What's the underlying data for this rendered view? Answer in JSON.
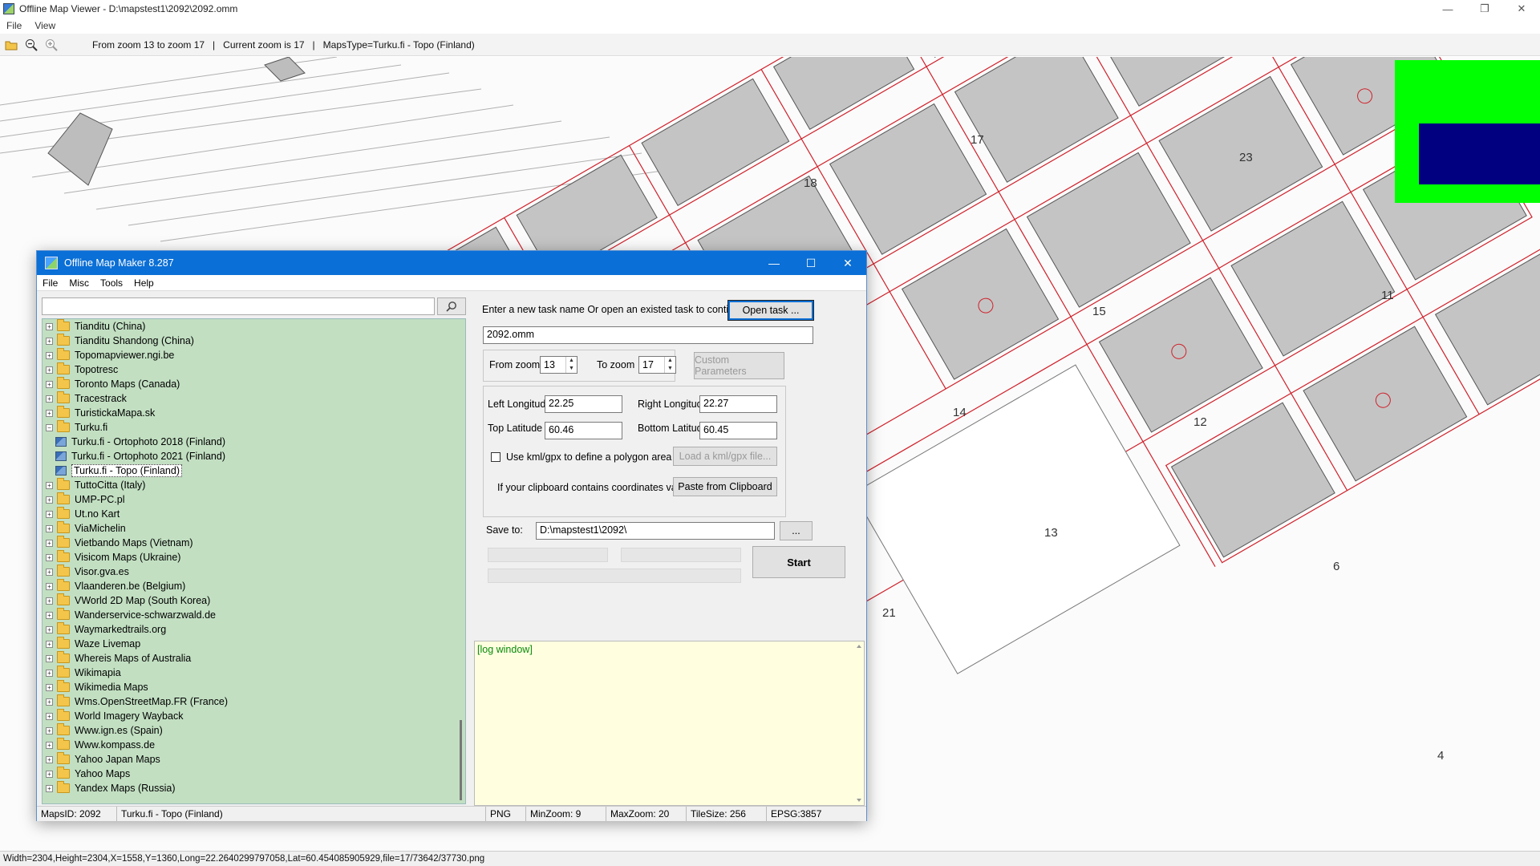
{
  "window": {
    "title": "Offline Map Viewer - D:\\mapstest1\\2092\\2092.omm",
    "menu": [
      "File",
      "View"
    ],
    "controls": [
      "—",
      "❐",
      "✕"
    ]
  },
  "toolbar": {
    "info": "From zoom 13 to zoom 17   |   Current zoom is 17   |   MapsType=Turku.fi - Topo (Finland)"
  },
  "map": {
    "labels": [
      "17",
      "23",
      "18",
      "15",
      "11",
      "14",
      "12",
      "13",
      "6",
      "4",
      "21"
    ],
    "overview_colors": {
      "outer": "#00ff00",
      "inner": "#000080"
    }
  },
  "status": {
    "text": "Width=2304,Height=2304,X=1558,Y=1360,Long=22.2640299797058,Lat=60.454085905929,file=17/73642/37730.png"
  },
  "dialog": {
    "title": "Offline Map Maker 8.287",
    "menu": [
      "File",
      "Misc",
      "Tools",
      "Help"
    ],
    "search": {
      "value": "",
      "placeholder": ""
    },
    "tree": [
      {
        "label": "Tianditu (China)",
        "type": "folder",
        "exp": "+"
      },
      {
        "label": "Tianditu Shandong (China)",
        "type": "folder",
        "exp": "+"
      },
      {
        "label": "Topomapviewer.ngi.be",
        "type": "folder",
        "exp": "+"
      },
      {
        "label": "Topotresc",
        "type": "folder",
        "exp": "+"
      },
      {
        "label": "Toronto Maps (Canada)",
        "type": "folder",
        "exp": "+"
      },
      {
        "label": "Tracestrack",
        "type": "folder",
        "exp": "+"
      },
      {
        "label": "TuristickaMapa.sk",
        "type": "folder",
        "exp": "+"
      },
      {
        "label": "Turku.fi",
        "type": "folder",
        "exp": "−"
      },
      {
        "label": "Turku.fi - Ortophoto 2018 (Finland)",
        "type": "map"
      },
      {
        "label": "Turku.fi - Ortophoto 2021 (Finland)",
        "type": "map"
      },
      {
        "label": "Turku.fi - Topo (Finland)",
        "type": "map",
        "selected": true
      },
      {
        "label": "TuttoCitta (Italy)",
        "type": "folder",
        "exp": "+"
      },
      {
        "label": "UMP-PC.pl",
        "type": "folder",
        "exp": "+"
      },
      {
        "label": "Ut.no Kart",
        "type": "folder",
        "exp": "+"
      },
      {
        "label": "ViaMichelin",
        "type": "folder",
        "exp": "+"
      },
      {
        "label": "Vietbando Maps (Vietnam)",
        "type": "folder",
        "exp": "+"
      },
      {
        "label": "Visicom Maps (Ukraine)",
        "type": "folder",
        "exp": "+"
      },
      {
        "label": "Visor.gva.es",
        "type": "folder",
        "exp": "+"
      },
      {
        "label": "Vlaanderen.be (Belgium)",
        "type": "folder",
        "exp": "+"
      },
      {
        "label": "VWorld 2D Map (South Korea)",
        "type": "folder",
        "exp": "+"
      },
      {
        "label": "Wanderservice-schwarzwald.de",
        "type": "folder",
        "exp": "+"
      },
      {
        "label": "Waymarkedtrails.org",
        "type": "folder",
        "exp": "+"
      },
      {
        "label": "Waze Livemap",
        "type": "folder",
        "exp": "+"
      },
      {
        "label": "Whereis Maps of Australia",
        "type": "folder",
        "exp": "+"
      },
      {
        "label": "Wikimapia",
        "type": "folder",
        "exp": "+"
      },
      {
        "label": "Wikimedia Maps",
        "type": "folder",
        "exp": "+"
      },
      {
        "label": "Wms.OpenStreetMap.FR (France)",
        "type": "folder",
        "exp": "+"
      },
      {
        "label": "World Imagery Wayback",
        "type": "folder",
        "exp": "+"
      },
      {
        "label": "Www.ign.es (Spain)",
        "type": "folder",
        "exp": "+"
      },
      {
        "label": "Www.kompass.de",
        "type": "folder",
        "exp": "+"
      },
      {
        "label": "Yahoo Japan Maps",
        "type": "folder",
        "exp": "+"
      },
      {
        "label": "Yahoo Maps",
        "type": "folder",
        "exp": "+"
      },
      {
        "label": "Yandex Maps (Russia)",
        "type": "folder",
        "exp": "+"
      }
    ],
    "task": {
      "prompt": "Enter a new task name Or open an existed task to continue:",
      "open_button": "Open task ...",
      "name": "2092.omm"
    },
    "zoom": {
      "from_label": "From zoom",
      "from_value": "13",
      "to_label": "To zoom",
      "to_value": "17",
      "custom_button": "Custom Parameters"
    },
    "coords": {
      "left_lon_label": "Left Longitude",
      "left_lon": "22.25",
      "right_lon_label": "Right Longitude",
      "right_lon": "22.27",
      "top_lat_label": "Top Latitude",
      "top_lat": "60.46",
      "bottom_lat_label": "Bottom Latitude",
      "bottom_lat": "60.45",
      "kml_label": "Use kml/gpx to define a polygon area",
      "kml_button": "Load a kml/gpx file...",
      "clipboard_label": "If your clipboard contains coordinates values:",
      "clipboard_button": "Paste from Clipboard"
    },
    "save": {
      "label": "Save to:",
      "path": "D:\\mapstest1\\2092\\",
      "browse": "...",
      "start": "Start"
    },
    "log": "[log window]",
    "statusbar": [
      "MapsID: 2092",
      "Turku.fi - Topo (Finland)",
      "PNG",
      "MinZoom: 9",
      "MaxZoom: 20",
      "TileSize: 256",
      "EPSG:3857"
    ]
  }
}
